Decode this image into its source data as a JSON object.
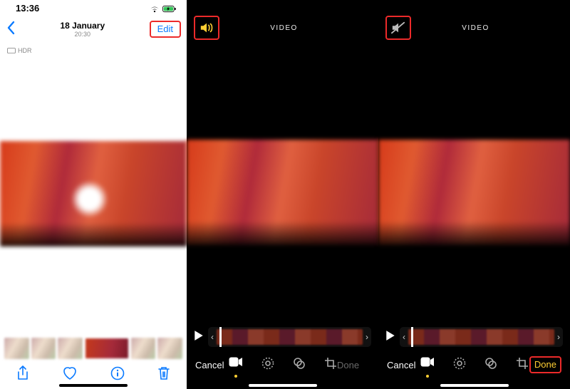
{
  "pane1": {
    "status": {
      "time": "13:36"
    },
    "nav": {
      "date": "18 January",
      "time": "20:30",
      "edit": "Edit"
    },
    "hdr_badge": "HDR"
  },
  "pane2": {
    "caption": "VIDEO",
    "audio_state": "on",
    "cancel": "Cancel",
    "done": "Done"
  },
  "pane3": {
    "caption": "VIDEO",
    "audio_state": "off",
    "cancel": "Cancel",
    "done": "Done"
  },
  "icons": {
    "sound_on": "sound-on-icon",
    "sound_off": "sound-off-icon"
  }
}
